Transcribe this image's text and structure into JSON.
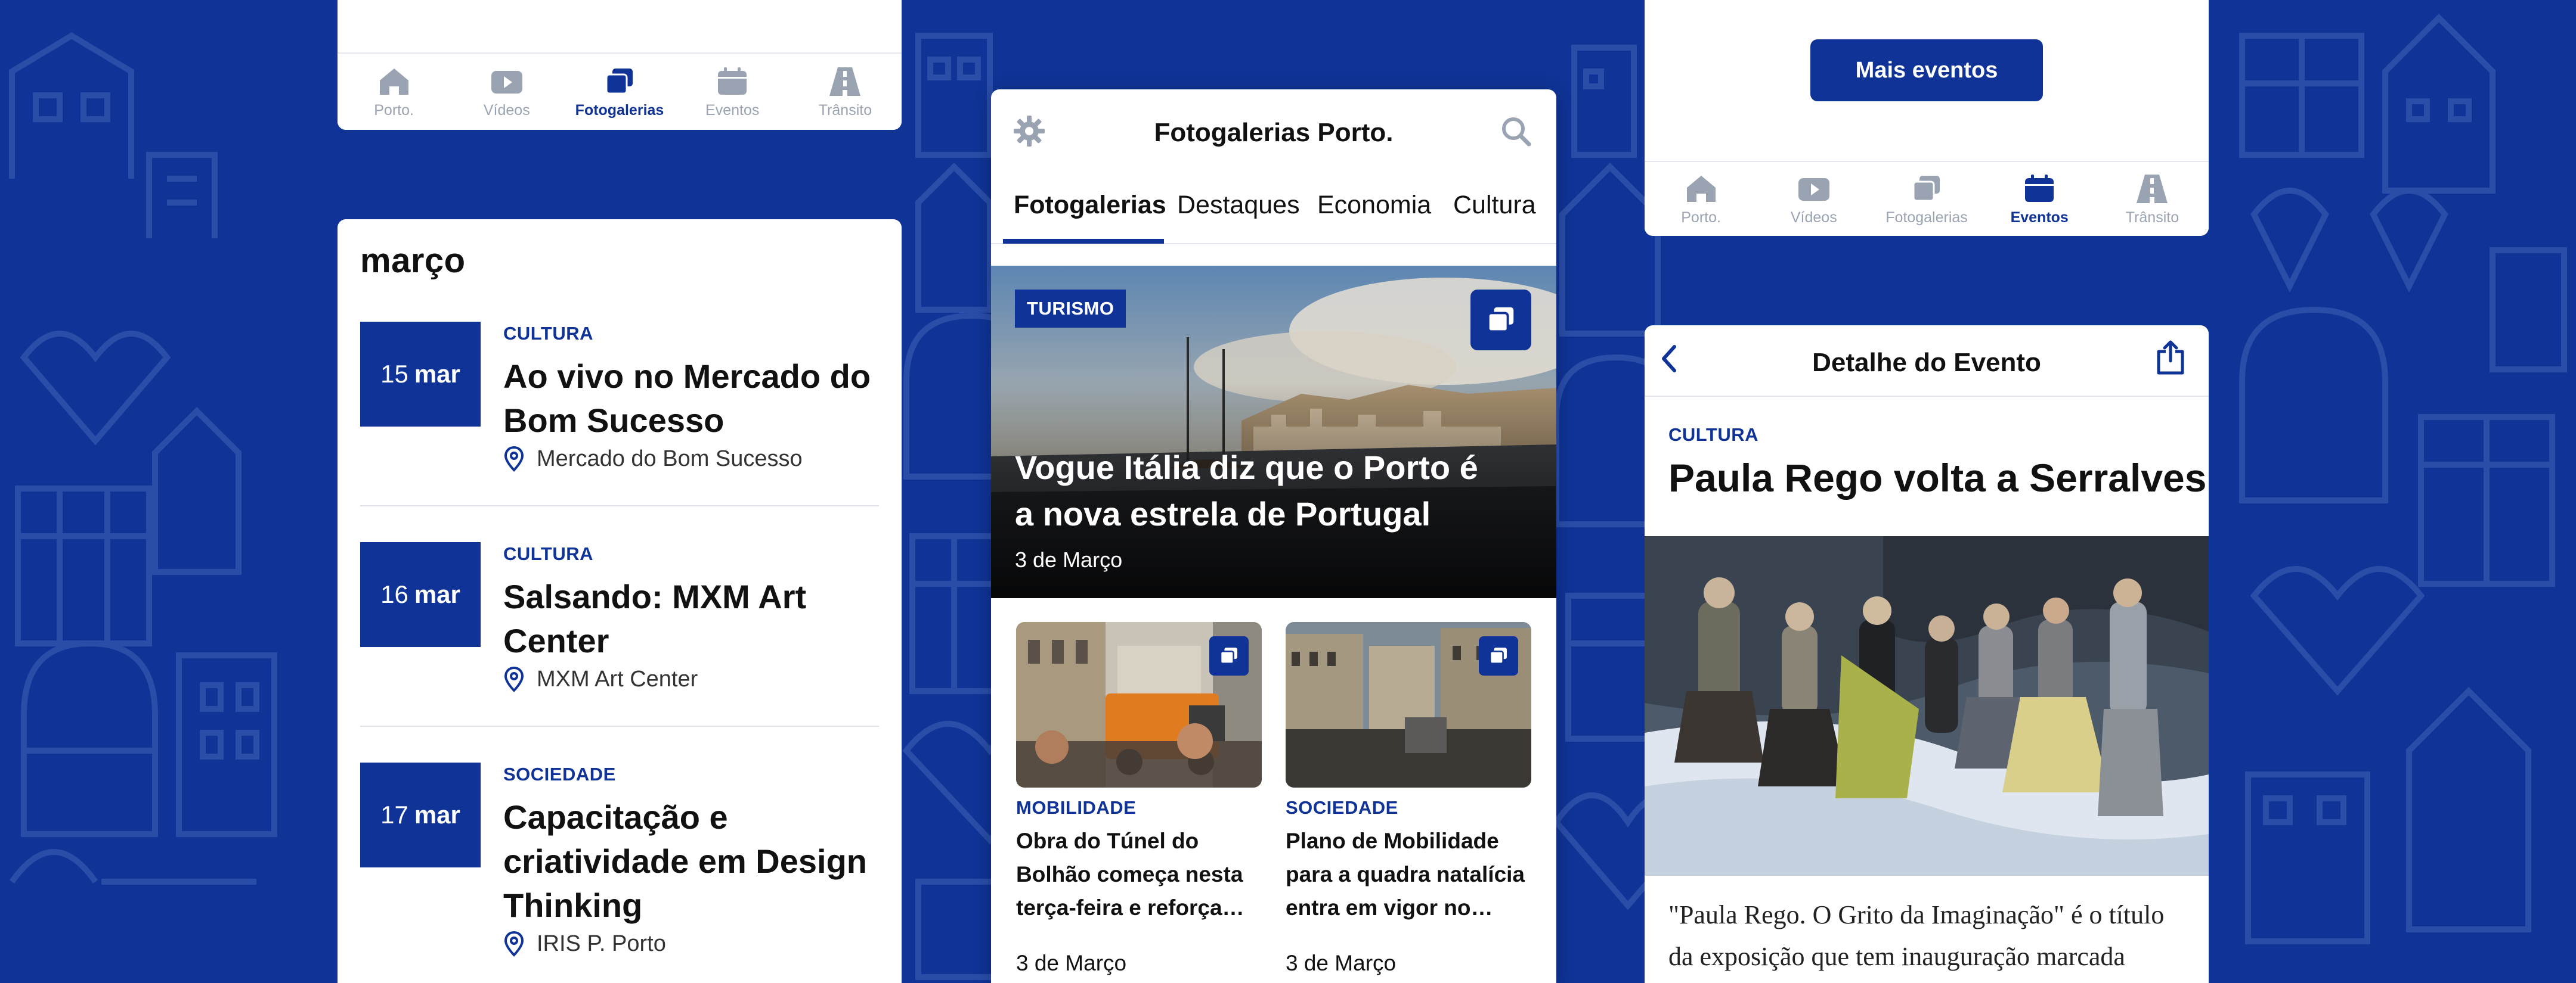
{
  "colors": {
    "brand": "#0f3396",
    "background": "#0f3396",
    "text": "#111111",
    "muted": "#9aa3b2"
  },
  "nav": [
    {
      "label": "Porto.",
      "icon": "home-icon"
    },
    {
      "label": "Vídeos",
      "icon": "video-play-icon"
    },
    {
      "label": "Fotogalerias",
      "icon": "gallery-icon"
    },
    {
      "label": "Eventos",
      "icon": "calendar-icon"
    },
    {
      "label": "Trânsito",
      "icon": "road-icon"
    }
  ],
  "panel_left_top": {
    "active_nav": "Fotogalerias"
  },
  "events": {
    "month": "março",
    "items": [
      {
        "day": "15",
        "month_abbr": "mar",
        "category": "CULTURA",
        "title": "Ao vivo no Mercado do Bom Sucesso",
        "location": "Mercado do Bom Sucesso"
      },
      {
        "day": "16",
        "month_abbr": "mar",
        "category": "CULTURA",
        "title": "Salsando: MXM Art Center",
        "location": "MXM Art Center"
      },
      {
        "day": "17",
        "month_abbr": "mar",
        "category": "SOCIEDADE",
        "title": "Capacitação e criatividade em Design Thinking",
        "location": "IRIS P. Porto"
      }
    ]
  },
  "gallery": {
    "title": "Fotogalerias Porto.",
    "tabs": [
      "Fotogalerias",
      "Destaques",
      "Economia",
      "Cultura"
    ],
    "hero": {
      "badge": "TURISMO",
      "title": "Vogue Itália diz que o Porto é a nova estrela de Portugal",
      "date": "3 de Março"
    },
    "cards": [
      {
        "category": "MOBILIDADE",
        "title": "Obra do Túnel do Bolhão começa nesta terça-feira e reforça…",
        "date": "3 de Março"
      },
      {
        "category": "SOCIEDADE",
        "title": "Plano de Mobilidade para a quadra natalícia entra em vigor no…",
        "date": "3 de Março"
      }
    ]
  },
  "panel_right_top": {
    "button": "Mais eventos",
    "active_nav": "Eventos"
  },
  "detail": {
    "title": "Detalhe do Evento",
    "category": "CULTURA",
    "headline": "Paula Rego volta a Serralves",
    "body": "\"Paula Rego. O Grito da Imaginação\" é o título da exposição que tem inauguração marcada"
  }
}
